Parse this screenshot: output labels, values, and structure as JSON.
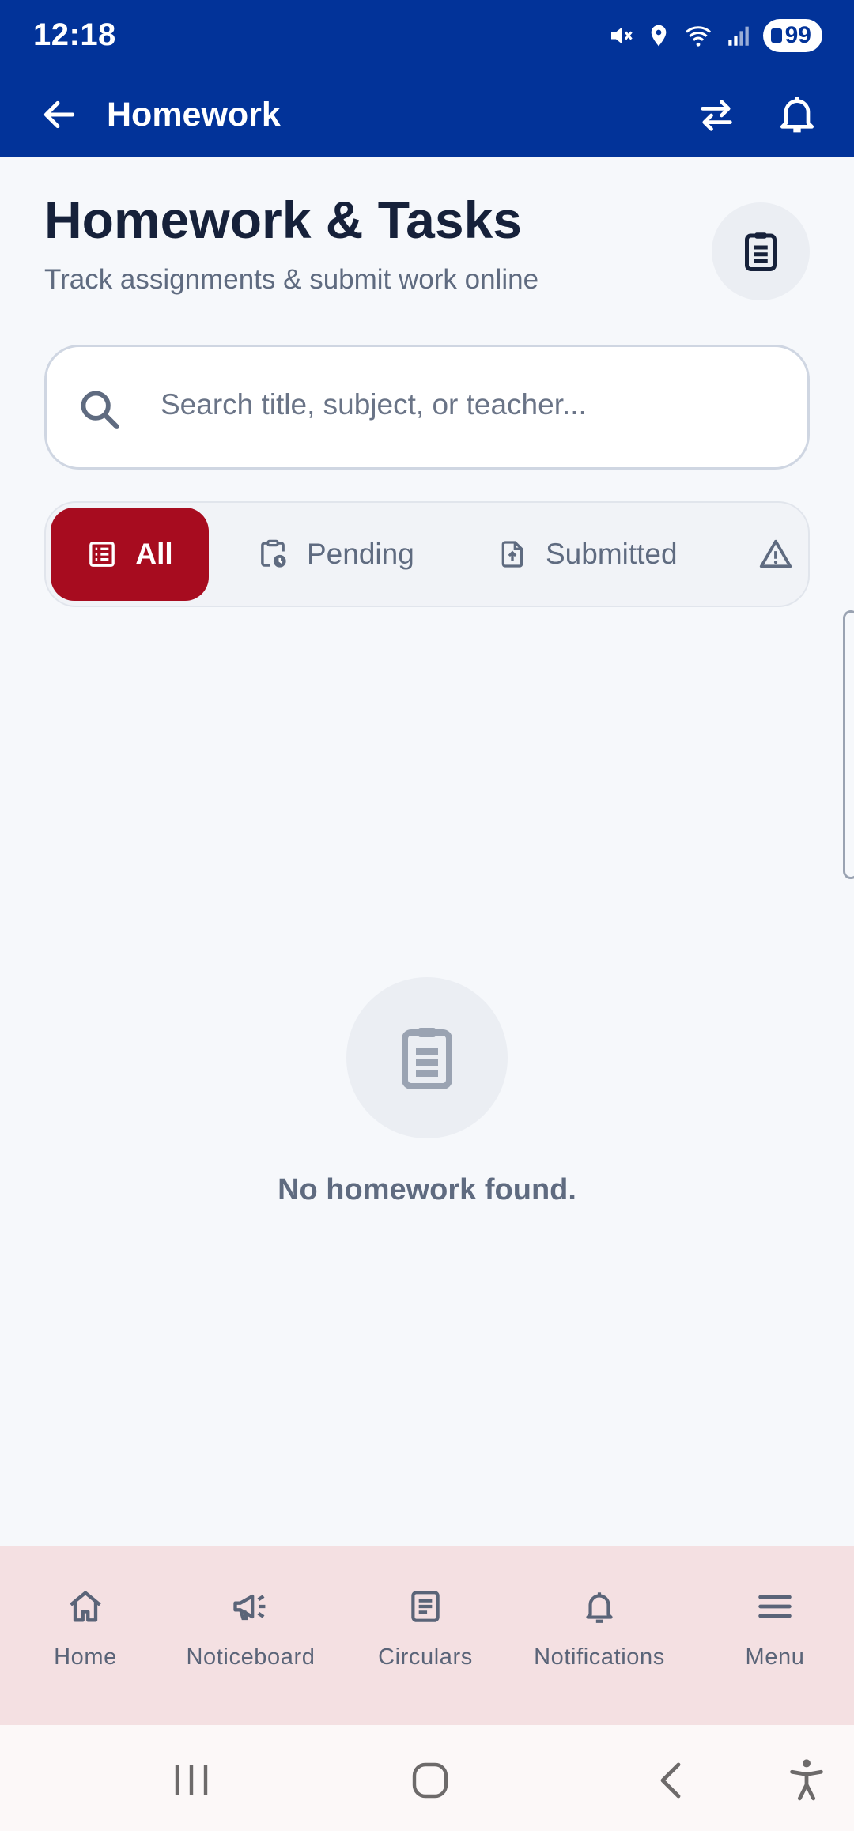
{
  "status_bar": {
    "time": "12:18",
    "battery": "99",
    "icons": [
      "mute-icon",
      "location-icon",
      "wifi-icon",
      "signal-icon",
      "battery-icon"
    ]
  },
  "app_bar": {
    "title": "Homework",
    "background": "#023399"
  },
  "header": {
    "title": "Homework & Tasks",
    "subtitle": "Track assignments & submit work online",
    "icon": "clipboard-icon"
  },
  "search": {
    "placeholder": "Search title, subject, or teacher..."
  },
  "tabs": [
    {
      "label": "All",
      "icon": "list-icon",
      "active": true
    },
    {
      "label": "Pending",
      "icon": "clipboard-clock-icon",
      "active": false
    },
    {
      "label": "Submitted",
      "icon": "file-upload-icon",
      "active": false
    },
    {
      "label": "",
      "icon": "warning-icon",
      "active": false
    }
  ],
  "empty_state": {
    "message": "No homework found.",
    "icon": "clipboard-icon"
  },
  "bottom_nav": [
    {
      "label": "Home",
      "icon": "home-icon"
    },
    {
      "label": "Noticeboard",
      "icon": "megaphone-icon"
    },
    {
      "label": "Circulars",
      "icon": "document-icon"
    },
    {
      "label": "Notifications",
      "icon": "bell-icon"
    },
    {
      "label": "Menu",
      "icon": "menu-icon"
    }
  ],
  "colors": {
    "primary": "#023399",
    "accent": "#a70c1f",
    "nav_background": "#f4e0e2"
  }
}
